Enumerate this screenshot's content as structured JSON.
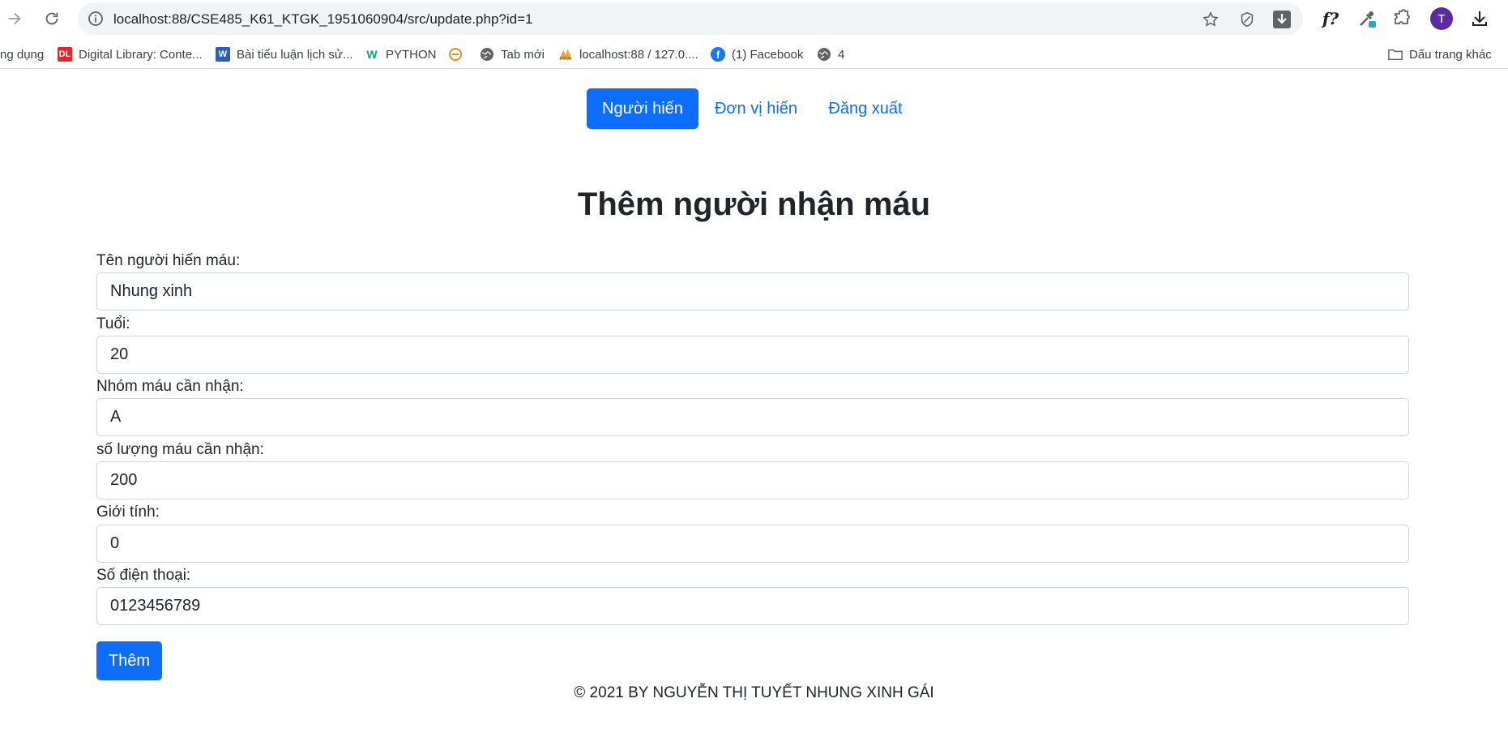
{
  "browser": {
    "url": "localhost:88/CSE485_K61_KTGK_1951060904/src/update.php?id=1",
    "profile_initial": "T",
    "ext_formula": "f?",
    "bookmarks": [
      {
        "label": "ng dụng",
        "icon": "apps-icon"
      },
      {
        "label": "Digital Library: Conte...",
        "icon": "dl-icon",
        "badge": "DL",
        "color": "#e8232a"
      },
      {
        "label": "Bài tiểu luận lịch sử...",
        "icon": "word-icon",
        "badge": "W",
        "color": "#2b5fb8"
      },
      {
        "label": "PYTHON",
        "icon": "w3-icon",
        "badge": "W",
        "color": "#04aa6d"
      },
      {
        "label": "",
        "icon": "site-icon"
      },
      {
        "label": "Tab mới",
        "icon": "globe-icon"
      },
      {
        "label": "localhost:88 / 127.0....",
        "icon": "pma-icon"
      },
      {
        "label": "(1) Facebook",
        "icon": "facebook-icon",
        "color": "#1877f2"
      },
      {
        "label": "4",
        "icon": "globe-icon"
      }
    ],
    "other_bookmarks": "Dấu trang khác"
  },
  "nav": {
    "items": [
      {
        "label": "Người hiến",
        "active": true
      },
      {
        "label": "Đơn vị hiến",
        "active": false
      },
      {
        "label": "Đăng xuất",
        "active": false
      }
    ]
  },
  "form": {
    "title": "Thêm người nhận máu",
    "fields": [
      {
        "label": "Tên người hiến máu:",
        "value": "Nhung xinh"
      },
      {
        "label": "Tuổi:",
        "value": "20"
      },
      {
        "label": "Nhóm máu cần nhận:",
        "value": "A"
      },
      {
        "label": "số lượng máu cần nhận:",
        "value": "200"
      },
      {
        "label": "Giới tính:",
        "value": "0"
      },
      {
        "label": "Số điện thoại:",
        "value": "0123456789"
      }
    ],
    "submit_label": "Thêm"
  },
  "footer": "© 2021 BY NGUYỄN THỊ TUYẾT NHUNG XINH GÁI",
  "colors": {
    "primary": "#0d6efd",
    "avatar": "#5b2ca0"
  }
}
